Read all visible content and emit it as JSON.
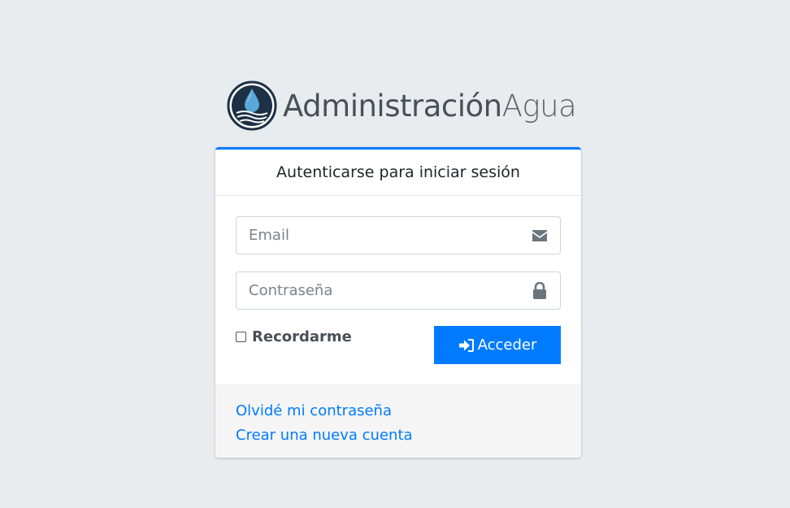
{
  "brand": {
    "name_bold": "Administración",
    "name_light": "Agua",
    "logo_icon": "water-drop-icon"
  },
  "login_card": {
    "header": "Autenticarse para iniciar sesión",
    "email": {
      "placeholder": "Email",
      "value": "",
      "icon": "envelope-icon"
    },
    "password": {
      "placeholder": "Contraseña",
      "value": "",
      "icon": "lock-icon"
    },
    "remember_label": "Recordarme",
    "remember_checked": false,
    "submit_label": "Acceder",
    "submit_icon": "sign-in-icon"
  },
  "footer_links": {
    "forgot_password": "Olvidé mi contraseña",
    "register": "Crear una nueva cuenta"
  },
  "colors": {
    "accent": "#007bff",
    "background": "#e9ecef",
    "link": "#007bff"
  }
}
